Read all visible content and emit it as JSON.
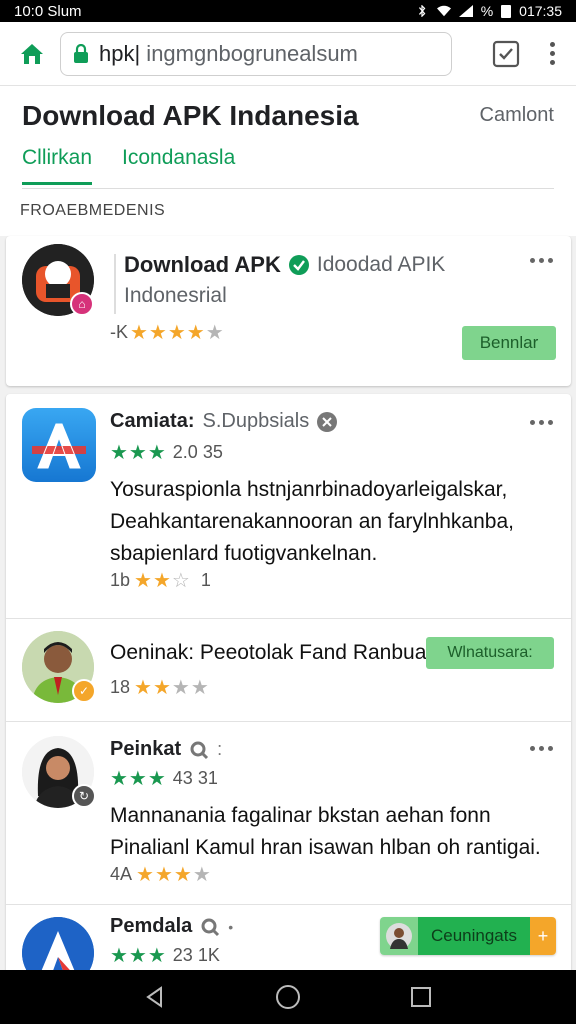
{
  "status_bar": {
    "time": "10:0 Slum",
    "battery_text": "%",
    "clock_right": "017:35"
  },
  "browser": {
    "url_host": "hpk|",
    "url_rest": " ingmgnbogrunealsum"
  },
  "page": {
    "title": "Download APK Indanesia",
    "action": "Camlont",
    "tabs": [
      {
        "label": "Cllirkan"
      },
      {
        "label": "Icondanasla"
      }
    ],
    "section_label": "FROAEBMEDENIS"
  },
  "featured": {
    "name": "Download APK",
    "sub_inline": "Idoodad APIK",
    "sub_line2": "Indonesrial",
    "rating_prefix": "-K",
    "action_label": "Bennlar"
  },
  "items": [
    {
      "name": "Camiata:",
      "sub": "S.Dupbsials",
      "rating_text": "2.0 35",
      "desc_lines": [
        "Yosuraspionla hstnjanrbinadoyarleigalskar,",
        "Deahkantarenakannooran an farylnhkanba,",
        "sbapienlard fuotigvankelnan."
      ],
      "meta_prefix": "1b",
      "meta_suffix": "1"
    },
    {
      "name": "Oeninak: Peeotolak Fand Ranbuan",
      "action_label": "Wlnatusara:",
      "meta_prefix": "18"
    },
    {
      "name": "Peinkat",
      "rating_text": "43 31",
      "desc_lines": [
        "Mannanania fagalinar bkstan aehan fonn",
        "Pinalianl Kamul hran isawan hlban oh rantigai."
      ],
      "meta_prefix": "4A"
    },
    {
      "name": "Pemdala",
      "rating_text": "23 1K",
      "action_label": "Ceuningats",
      "action_plus": "+"
    }
  ]
}
